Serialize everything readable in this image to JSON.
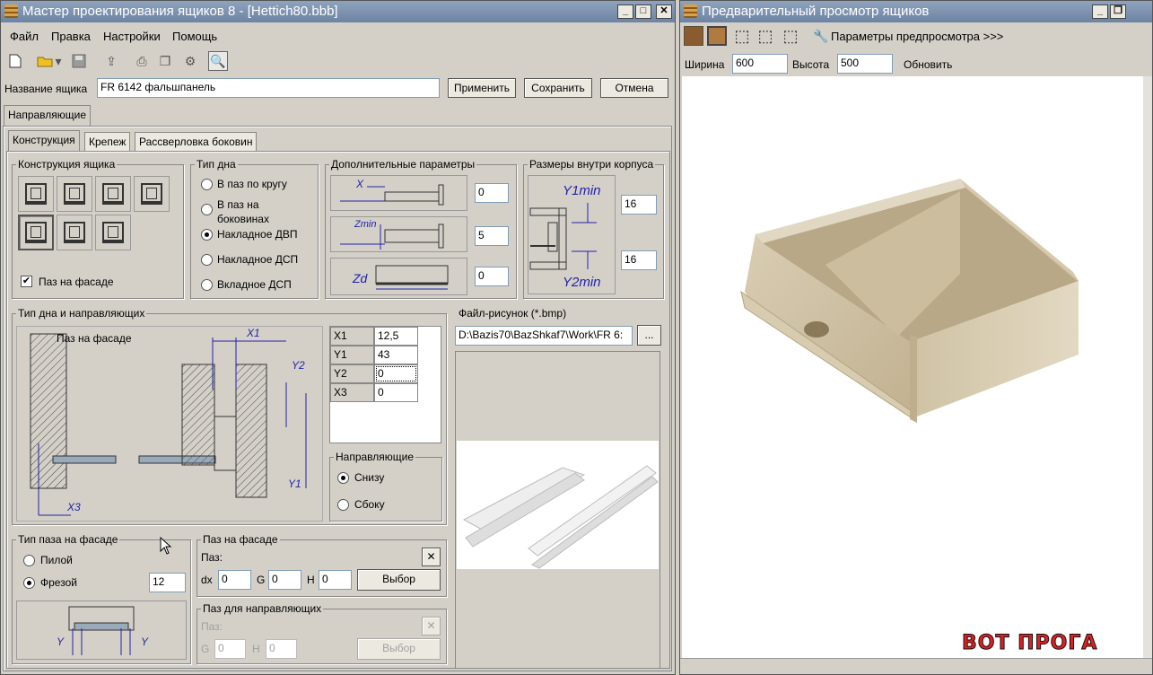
{
  "left": {
    "title": "Мастер проектирования ящиков 8 - [Hettich80.bbb]",
    "menu": [
      "Файл",
      "Правка",
      "Настройки",
      "Помощь"
    ],
    "name_label": "Название ящика",
    "name_value": "FR 6142 фальшпанель",
    "apply": "Применить",
    "save": "Сохранить",
    "cancel": "Отмена",
    "outer_tab": "Направляющие",
    "tabs": [
      "Конструкция",
      "Крепеж",
      "Рассверловка боковин"
    ],
    "construction": {
      "label": "Конструкция ящика",
      "facade_groove": "Паз на фасаде",
      "facade_groove_checked": true
    },
    "bottom_type": {
      "label": "Тип дна",
      "options": [
        "В паз по кругу",
        "В паз на боковинах",
        "Накладное ДВП",
        "Накладное ДСП",
        "Вкладное ДСП"
      ],
      "selected": 2
    },
    "extra": {
      "label": "Дополнительные параметры",
      "x_label": "X",
      "zmin_label": "Zmin",
      "zd_label": "Zd",
      "values": [
        "0",
        "5",
        "0"
      ]
    },
    "inner_size": {
      "label": "Размеры внутри корпуса",
      "y1": "Y1min",
      "y2": "Y2min",
      "v1": "16",
      "v2": "16"
    },
    "rail_type": {
      "label": "Тип дна и направляющих",
      "caption": "Паз на фасаде",
      "dims": [
        "X1",
        "Y2",
        "Y1",
        "X3"
      ],
      "table": [
        {
          "k": "X1",
          "v": "12,5"
        },
        {
          "k": "Y1",
          "v": "43"
        },
        {
          "k": "Y2",
          "v": "0"
        },
        {
          "k": "X3",
          "v": "0"
        }
      ],
      "guides_label": "Направляющие",
      "guides": [
        "Снизу",
        "Сбоку"
      ]
    },
    "file": {
      "label": "Файл-рисунок (*.bmp)",
      "path": "D:\\Bazis70\\BazShkaf7\\Work\\FR 6:",
      "browse": "..."
    },
    "groove_type": {
      "label": "Тип паза на фасаде",
      "options": [
        "Пилой",
        "Фрезой"
      ],
      "value": "12",
      "y": "Y"
    },
    "facade_groove": {
      "label": "Паз на фасаде",
      "paz": "Паз:",
      "dx": "dx",
      "dx_v": "0",
      "g": "G",
      "g_v": "0",
      "h": "H",
      "h_v": "0",
      "choose": "Выбор"
    },
    "rail_groove": {
      "label": "Паз для направляющих",
      "paz": "Паз:",
      "g": "G",
      "g_v": "0",
      "h": "H",
      "h_v": "0",
      "choose": "Выбор"
    }
  },
  "right": {
    "title": "Предварительный просмотр ящиков",
    "params": "Параметры предпросмотра >>>",
    "width_label": "Ширина",
    "width_value": "600",
    "height_label": "Высота",
    "height_value": "500",
    "refresh": "Обновить"
  },
  "watermark": "ВОТ ПРОГА"
}
